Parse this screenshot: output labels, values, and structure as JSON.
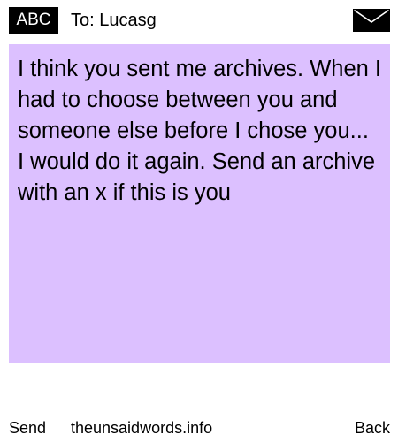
{
  "header": {
    "badge_label": "ABC",
    "recipient_line": "To: Lucasg",
    "icon": "envelope-icon"
  },
  "message": {
    "text": "I think you sent me archives. When I had to choose between you and someone else before I chose you... I would do it again. Send an archive with an x if this is you",
    "background_color": "#dcc0ff"
  },
  "footer": {
    "send_label": "Send",
    "site_label": "theunsaidwords.info",
    "back_label": "Back"
  }
}
